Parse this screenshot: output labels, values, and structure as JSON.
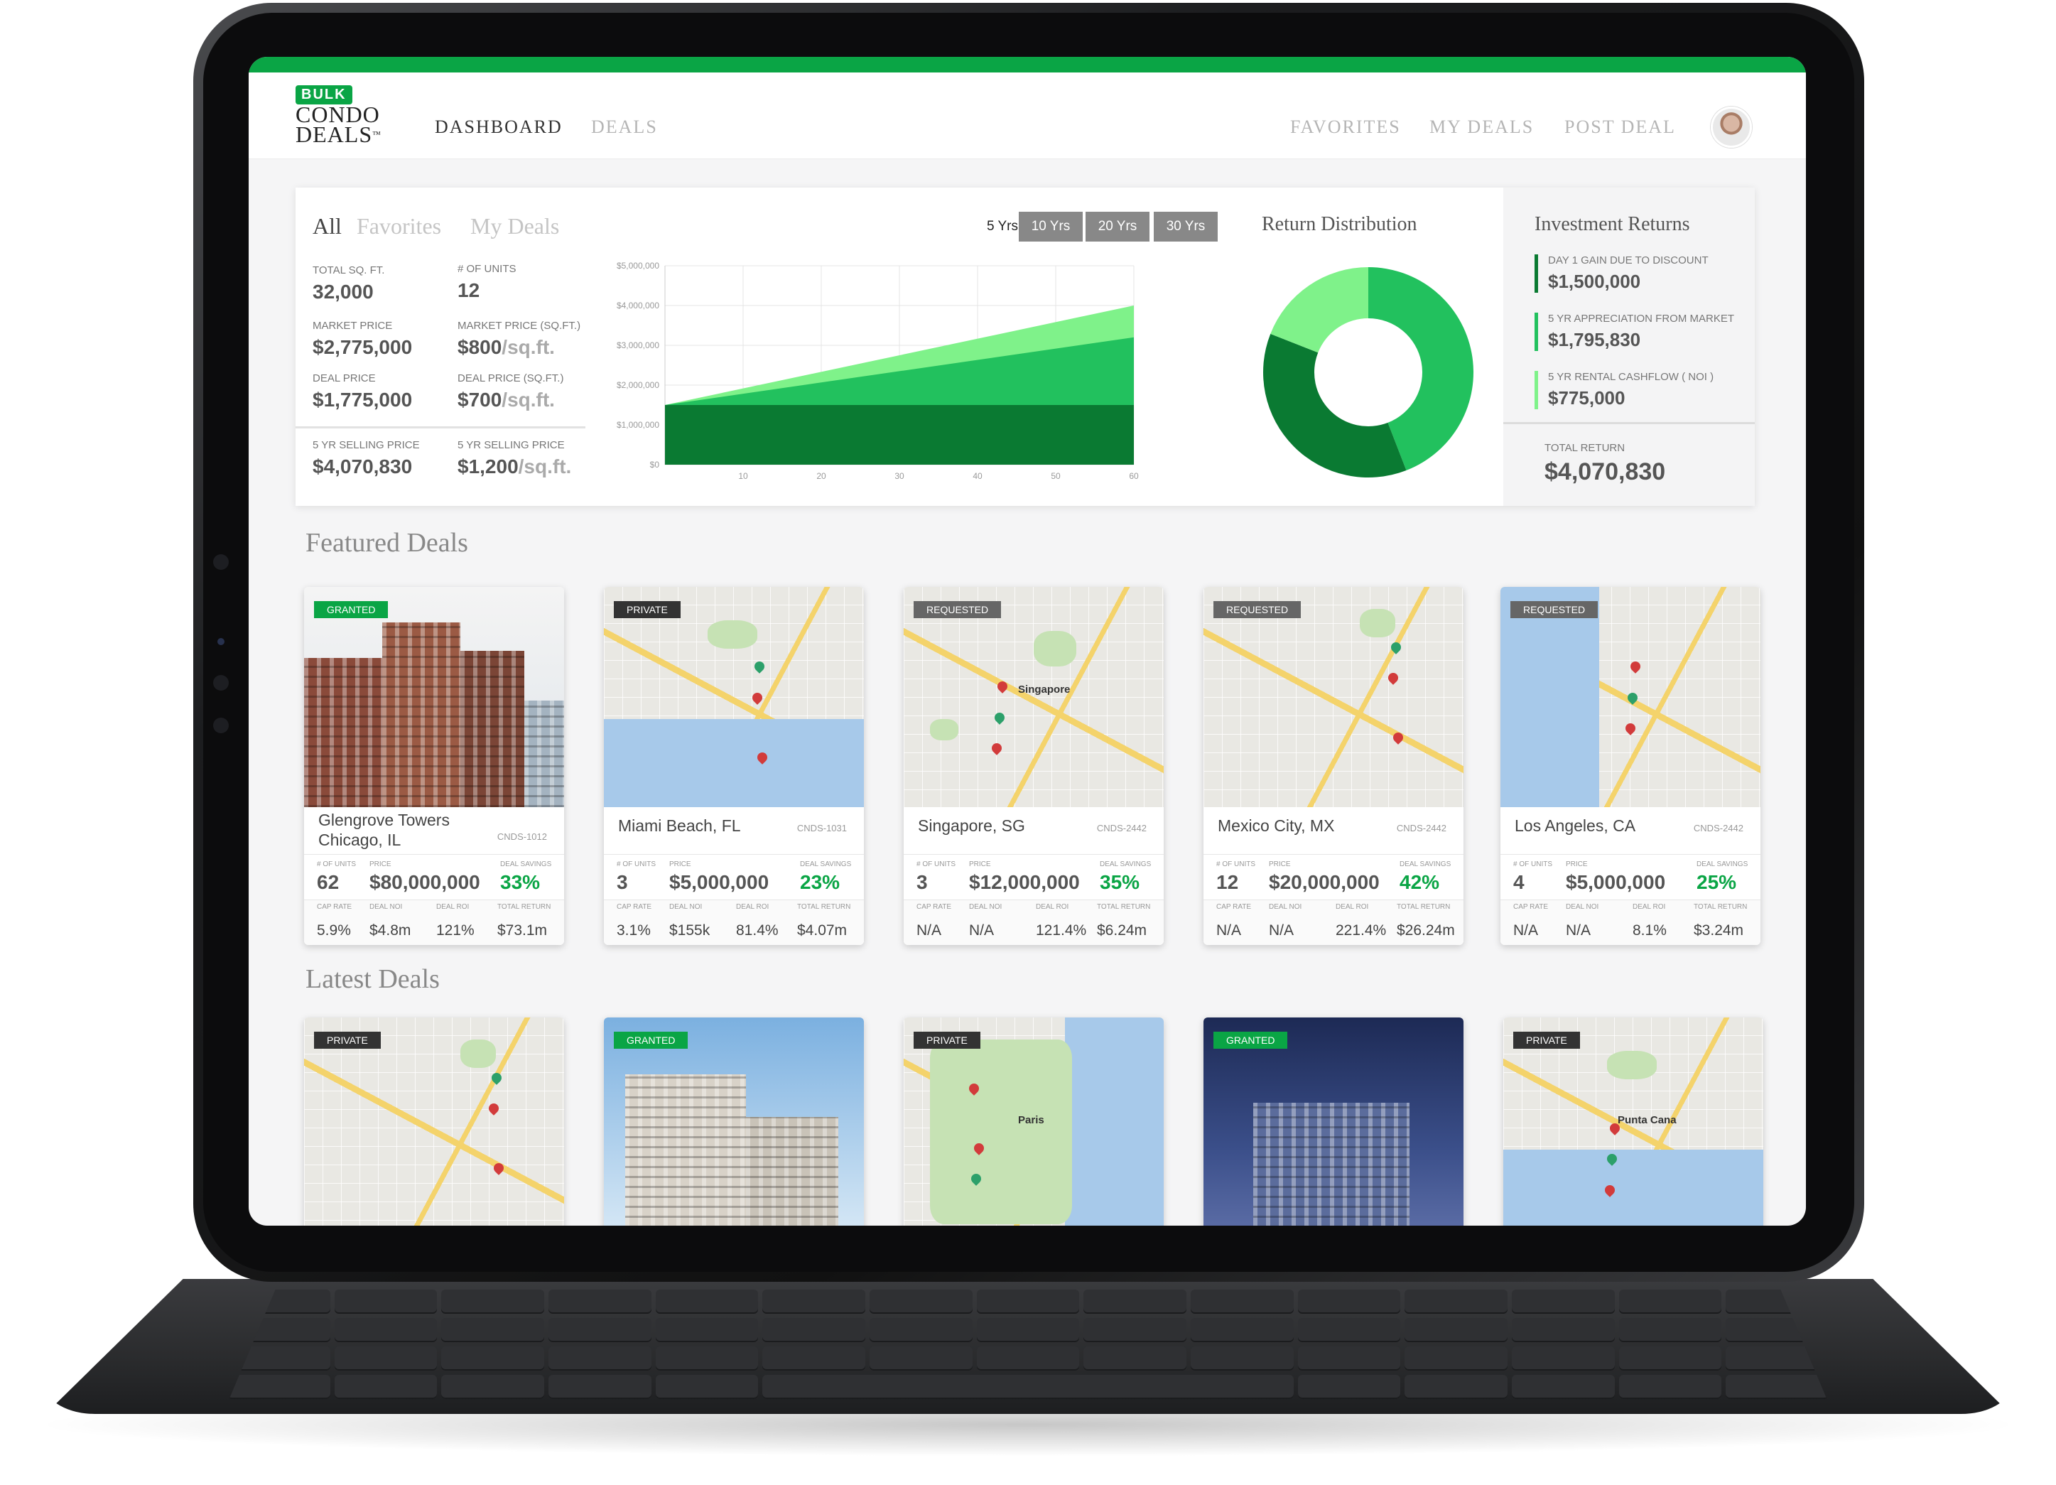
{
  "app": {
    "logo_badge": "BULK",
    "logo_line1": "CONDO",
    "logo_line2": "DEALS",
    "logo_tm": "™",
    "brand_color": "#0aa545"
  },
  "nav": {
    "dashboard": "DASHBOARD",
    "deals": "DEALS",
    "favorites": "FAVORITES",
    "my_deals": "MY DEALS",
    "post_deal": "POST DEAL"
  },
  "filters": {
    "all": "All",
    "favorites": "Favorites",
    "my_deals": "My Deals"
  },
  "stats": {
    "total_sqft_label": "TOTAL SQ. FT.",
    "total_sqft": "32,000",
    "units_label": "# OF UNITS",
    "units": "12",
    "market_price_label": "MARKET PRICE",
    "market_price": "$2,775,000",
    "market_sqft_label": "MARKET PRICE (SQ.FT.)",
    "market_sqft": "$800",
    "market_sqft_unit": "/sq.ft.",
    "deal_price_label": "DEAL PRICE",
    "deal_price": "$1,775,000",
    "deal_sqft_label": "DEAL PRICE (SQ.FT.)",
    "deal_sqft": "$700",
    "deal_sqft_unit": "/sq.ft.",
    "sell_price_label": "5 YR SELLING PRICE",
    "sell_price": "$4,070,830",
    "sell_sqft_label": "5 YR SELLING PRICE",
    "sell_sqft": "$1,200",
    "sell_sqft_unit": "/sq.ft."
  },
  "year_buttons": [
    "5 Yrs",
    "10 Yrs",
    "20 Yrs",
    "30 Yrs"
  ],
  "return_distribution_title": "Return Distribution",
  "investment_returns": {
    "title": "Investment Returns",
    "items": [
      {
        "label": "DAY 1 GAIN DUE TO DISCOUNT",
        "value": "$1,500,000",
        "color": "#0a7a32"
      },
      {
        "label": "5 YR APPRECIATION FROM MARKET",
        "value": "$1,795,830",
        "color": "#22c15e"
      },
      {
        "label": "5 YR RENTAL CASHFLOW ( NOI )",
        "value": "$775,000",
        "color": "#7ff28a"
      }
    ],
    "total_label": "TOTAL RETURN",
    "total_value": "$4,070,830"
  },
  "chart_data": [
    {
      "type": "area",
      "x": [
        0,
        60
      ],
      "xticks": [
        "10",
        "20",
        "30",
        "40",
        "50",
        "60"
      ],
      "yticks": [
        "$0",
        "$1,000,000",
        "$2,000,000",
        "$3,000,000",
        "$4,000,000",
        "$5,000,000"
      ],
      "ylim": [
        0,
        5000000
      ],
      "xlim": [
        0,
        60
      ],
      "series": [
        {
          "values": [
            1500000,
            1500000
          ],
          "color": "#0a7a32"
        },
        {
          "values": [
            1500000,
            3200000
          ],
          "color": "#22c15e"
        },
        {
          "values": [
            1500000,
            4000000
          ],
          "color": "#7ff28a"
        }
      ],
      "grid": true
    },
    {
      "type": "pie",
      "donut": true,
      "values": [
        1795830,
        1500000,
        775000
      ],
      "colors": [
        "#22c15e",
        "#0a7a32",
        "#7ff28a"
      ]
    }
  ],
  "sections": {
    "featured": "Featured Deals",
    "latest": "Latest Deals"
  },
  "card_labels": {
    "units": "# OF UNITS",
    "price": "PRICE",
    "savings": "DEAL SAVINGS",
    "cap_rate": "CAP RATE",
    "deal_noi": "DEAL NOI",
    "deal_roi": "DEAL ROI",
    "total_return": "TOTAL RETURN"
  },
  "featured_deals": [
    {
      "badge": "GRANTED",
      "badge_type": "granted",
      "image": "building",
      "title": "Glengrove Towers Chicago, IL",
      "code": "CNDS-1012",
      "units": "62",
      "price": "$80,000,000",
      "savings": "33%",
      "cap_rate": "5.9%",
      "noi": "$4.8m",
      "roi": "121%",
      "total": "$73.1m"
    },
    {
      "badge": "PRIVATE",
      "badge_type": "private",
      "image": "map",
      "title": "Miami Beach, FL",
      "code": "CNDS-1031",
      "units": "3",
      "price": "$5,000,000",
      "savings": "23%",
      "cap_rate": "3.1%",
      "noi": "$155k",
      "roi": "81.4%",
      "total": "$4.07m"
    },
    {
      "badge": "REQUESTED",
      "badge_type": "requested",
      "image": "map",
      "title": "Singapore, SG",
      "code": "CNDS-2442",
      "units": "3",
      "price": "$12,000,000",
      "savings": "35%",
      "cap_rate": "N/A",
      "noi": "N/A",
      "roi": "121.4%",
      "total": "$6.24m",
      "map_label": "Singapore"
    },
    {
      "badge": "REQUESTED",
      "badge_type": "requested",
      "image": "map",
      "title": "Mexico City, MX",
      "code": "CNDS-2442",
      "units": "12",
      "price": "$20,000,000",
      "savings": "42%",
      "cap_rate": "N/A",
      "noi": "N/A",
      "roi": "221.4%",
      "total": "$26.24m"
    },
    {
      "badge": "REQUESTED",
      "badge_type": "requested",
      "image": "map",
      "title": "Los Angeles, CA",
      "code": "CNDS-2442",
      "units": "4",
      "price": "$5,000,000",
      "savings": "25%",
      "cap_rate": "N/A",
      "noi": "N/A",
      "roi": "8.1%",
      "total": "$3.24m"
    }
  ],
  "latest_deals": [
    {
      "badge": "PRIVATE",
      "badge_type": "private",
      "image": "map"
    },
    {
      "badge": "GRANTED",
      "badge_type": "granted",
      "image": "building"
    },
    {
      "badge": "PRIVATE",
      "badge_type": "private",
      "image": "map",
      "map_label": "Paris"
    },
    {
      "badge": "GRANTED",
      "badge_type": "granted",
      "image": "building-night"
    },
    {
      "badge": "PRIVATE",
      "badge_type": "private",
      "image": "map",
      "map_label": "Punta Cana"
    }
  ]
}
